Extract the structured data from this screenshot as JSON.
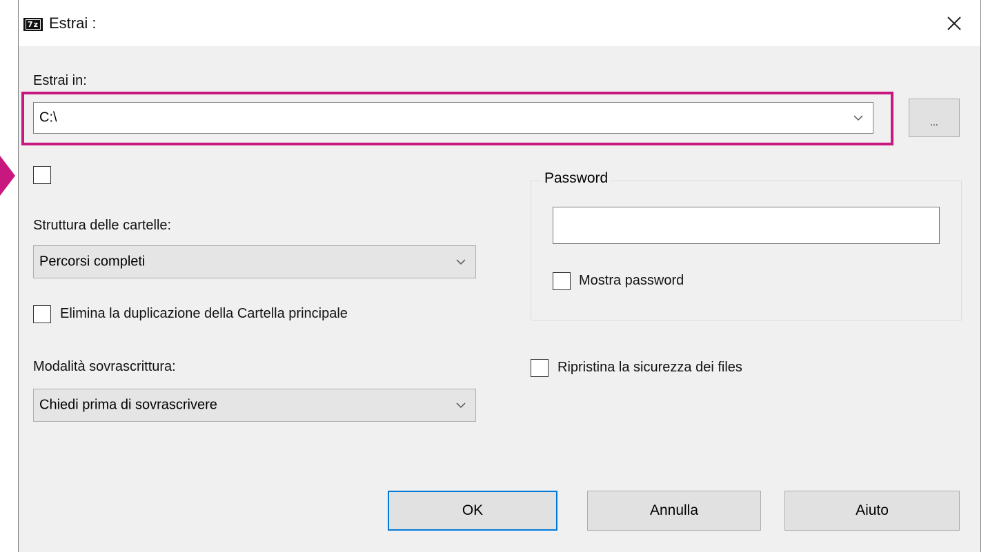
{
  "window": {
    "title": "Estrai :",
    "icon": "7z-app-icon",
    "icon_text": "7z",
    "close_icon": "close-icon"
  },
  "extract_to": {
    "label": "Estrai in:",
    "value": "C:\\",
    "browse_label": "...",
    "highlight_color": "#c8187f"
  },
  "unnamed_checkbox": {
    "checked": false
  },
  "folder_structure": {
    "label": "Struttura delle cartelle:",
    "selected": "Percorsi completi"
  },
  "eliminate_duplication": {
    "label": "Elimina la duplicazione della Cartella principale",
    "checked": false
  },
  "overwrite_mode": {
    "label": "Modalità sovrascrittura:",
    "selected": "Chiedi prima di sovrascrivere"
  },
  "password": {
    "group_label": "Password",
    "value": "",
    "show_label": "Mostra password",
    "show_checked": false
  },
  "restore_security": {
    "label": "Ripristina la sicurezza dei files",
    "checked": false
  },
  "buttons": {
    "ok": "OK",
    "cancel": "Annulla",
    "help": "Aiuto"
  },
  "colors": {
    "accent_focus": "#0078d7",
    "pointer_arrow": "#c8187f"
  }
}
